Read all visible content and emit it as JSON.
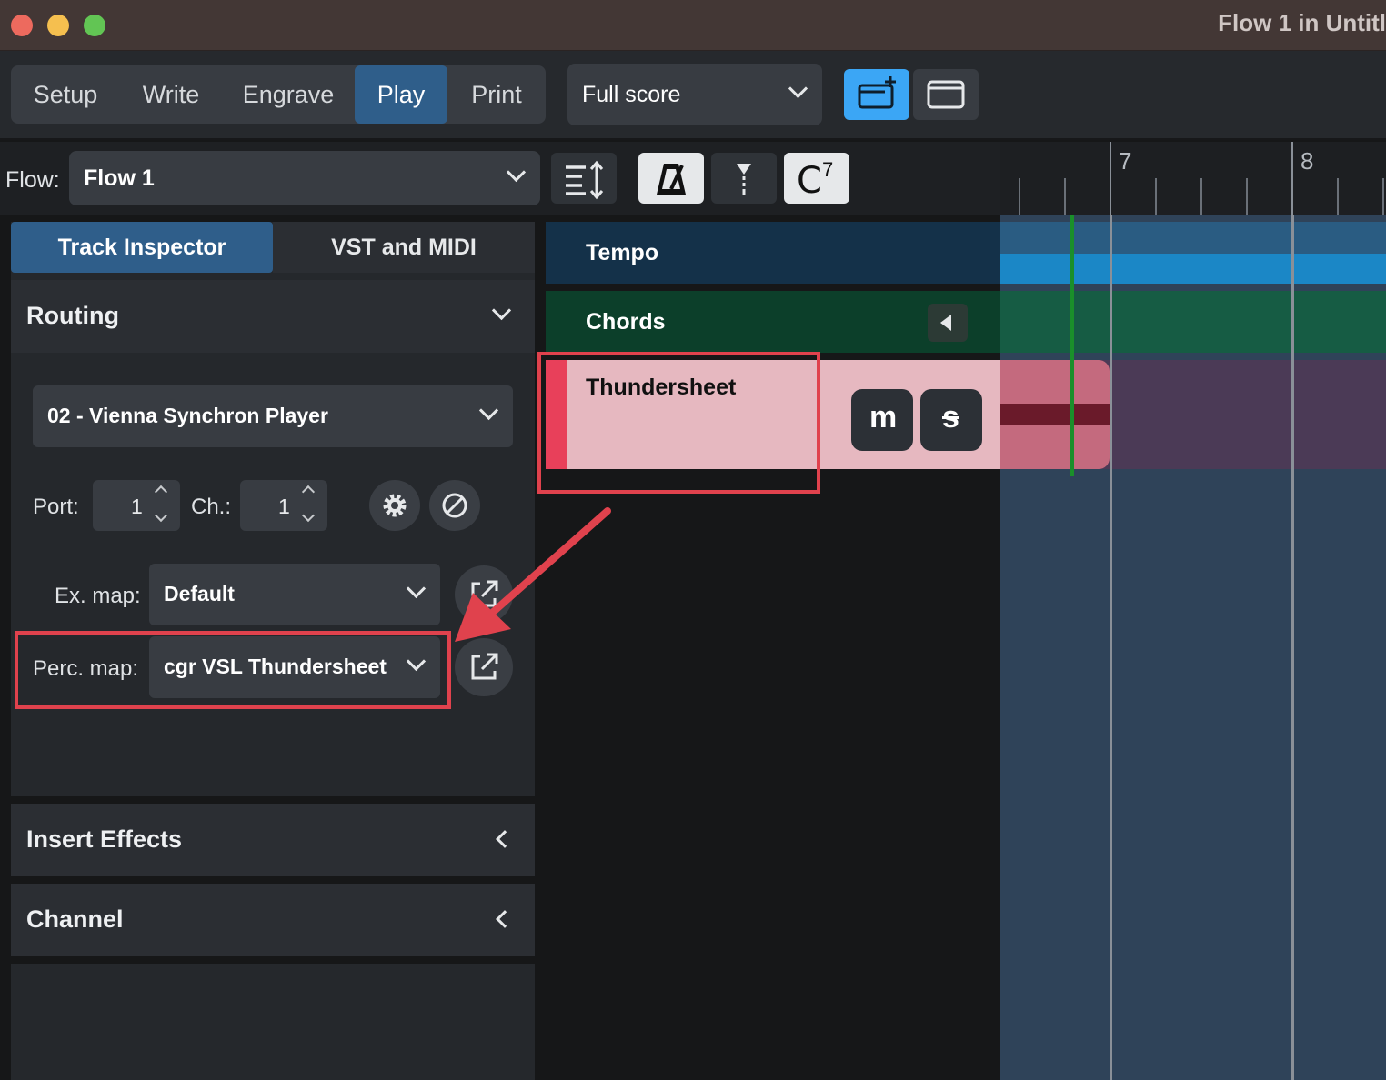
{
  "window": {
    "title": "Flow 1 in Untitl"
  },
  "modes": [
    "Setup",
    "Write",
    "Engrave",
    "Play",
    "Print"
  ],
  "active_mode": "Play",
  "layout_select": {
    "value": "Full score"
  },
  "flow": {
    "label": "Flow:",
    "value": "Flow 1"
  },
  "toolbar_icons": [
    "window-add-icon",
    "window-single-icon",
    "track-height-icon",
    "metronome-icon",
    "dynamics-icon",
    "chord-symbol-icon"
  ],
  "chord_btn": {
    "text": "C",
    "sup": "7"
  },
  "inspector_tabs": [
    "Track Inspector",
    "VST and MIDI"
  ],
  "routing": {
    "title": "Routing",
    "instrument": "02 - Vienna Synchron Player",
    "port_label": "Port:",
    "port": "1",
    "channel_label": "Ch.:",
    "channel": "1",
    "exmap_label": "Ex. map:",
    "exmap": "Default",
    "percmap_label": "Perc. map:",
    "percmap": "cgr VSL Thundersheet"
  },
  "sections": {
    "insert_effects": "Insert Effects",
    "channel": "Channel"
  },
  "tracks": {
    "tempo": "Tempo",
    "chords": "Chords",
    "instrument": "Thundersheet",
    "mute": "m",
    "solo": "s"
  },
  "ruler": {
    "bar7": "7",
    "bar8": "8"
  },
  "colors": {
    "accent": "#2f5e8a",
    "highlight": "#e0424d",
    "track_pink": "#e6b8c0",
    "playhead": "#1a8f2a"
  }
}
